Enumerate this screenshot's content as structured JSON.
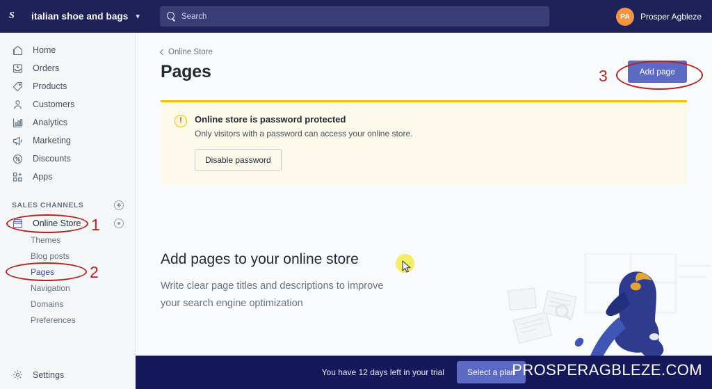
{
  "topbar": {
    "logo_icon": "shopify-bag-icon",
    "store_name": "italian shoe and bags",
    "store_caret_icon": "chevron-down-icon",
    "search": {
      "icon": "search-icon",
      "placeholder": "Search",
      "value": ""
    },
    "user": {
      "initials": "PA",
      "name": "Prosper Agbleze",
      "avatar_color": "#f49342"
    }
  },
  "sidebar": {
    "items": [
      {
        "label": "Home",
        "icon": "home-icon"
      },
      {
        "label": "Orders",
        "icon": "orders-inbox-icon"
      },
      {
        "label": "Products",
        "icon": "tag-icon"
      },
      {
        "label": "Customers",
        "icon": "person-icon"
      },
      {
        "label": "Analytics",
        "icon": "bar-chart-icon"
      },
      {
        "label": "Marketing",
        "icon": "megaphone-icon"
      },
      {
        "label": "Discounts",
        "icon": "discount-percent-icon"
      },
      {
        "label": "Apps",
        "icon": "apps-grid-plus-icon"
      }
    ],
    "section": {
      "title": "SALES CHANNELS",
      "add_icon": "plus-circle-icon"
    },
    "channel": {
      "label": "Online Store",
      "icon": "online-store-icon",
      "view_icon": "eye-circle-icon"
    },
    "sub_items": [
      {
        "label": "Themes",
        "active": false
      },
      {
        "label": "Blog posts",
        "active": false
      },
      {
        "label": "Pages",
        "active": true
      },
      {
        "label": "Navigation",
        "active": false
      },
      {
        "label": "Domains",
        "active": false
      },
      {
        "label": "Preferences",
        "active": false
      }
    ],
    "settings": {
      "label": "Settings",
      "icon": "gear-icon"
    }
  },
  "main": {
    "breadcrumb": {
      "label": "Online Store",
      "icon": "chevron-left-icon"
    },
    "page_title": "Pages",
    "add_page_button": "Add page",
    "banner": {
      "icon": "warning-circle-icon",
      "title": "Online store is password protected",
      "text": "Only visitors with a password can access your online store.",
      "button": "Disable password"
    },
    "empty_state": {
      "title": "Add pages to your online store",
      "subtitle": "Write clear page titles and descriptions to improve your search engine optimization",
      "illustration": "person-reading-documents-illustration"
    }
  },
  "trialbar": {
    "text": "You have 12 days left in your trial",
    "button": "Select a plan"
  },
  "watermark": "PROSPERAGBLEZE.COM",
  "annotations": [
    {
      "number": "1",
      "target": "Online Store"
    },
    {
      "number": "2",
      "target": "Pages"
    },
    {
      "number": "3",
      "target": "Add page"
    }
  ],
  "cursor": {
    "icon": "mouse-pointer-icon",
    "highlight_color": "#f2ea4c"
  },
  "colors": {
    "topbar": "#1f2259",
    "accent": "#5c6ac4",
    "banner_border": "#eec200",
    "banner_bg": "#fcf8ea",
    "annotation_red": "#b2241f",
    "trialbar": "#16185c"
  }
}
